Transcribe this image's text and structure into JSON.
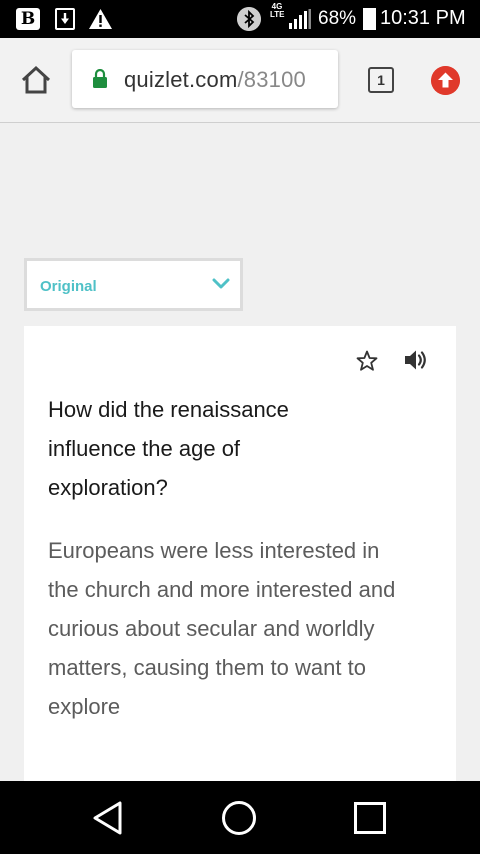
{
  "status_bar": {
    "notification_b": "B",
    "network_type": "4G LTE",
    "battery_percent": "68%",
    "time": "10:31 PM"
  },
  "browser": {
    "url_domain": "quizlet.com",
    "url_path": "/83100",
    "tab_count": "1"
  },
  "term_select": {
    "selected": "Original"
  },
  "card": {
    "question": "How did the renaissance influence the age of exploration?",
    "answer": "Europeans were less interested in the church and more interested and curious about secular and worldly matters, causing them to want to explore"
  },
  "colors": {
    "accent_teal": "#4fc1c7",
    "lock_green": "#1e8e3e",
    "update_red": "#e0392b"
  }
}
